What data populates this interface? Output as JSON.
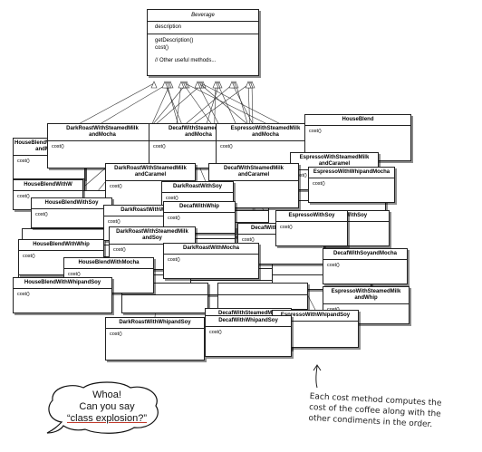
{
  "beverage": {
    "title": "Beverage",
    "field": "description",
    "method1": "getDescription()",
    "method2": "cost()",
    "method3": "// Other useful methods..."
  },
  "method_label": "cost()",
  "classes": [
    "HouseBlendWithSteamedMilk\nandMocha",
    "DarkRoastWithSteamedMilk\nandMocha",
    "DecafWithSteamedMilk\nandMocha",
    "EspressoWithSteamedMilk\nandMocha",
    "HouseBlend",
    "EspressoWithSteamedMilk\nandCaramel",
    "DarkRoastWithSteamedMilk\nandCaramel",
    "DecafWithSteamedMilk\nandCaramel",
    "EspressoWithWhipandMocha",
    "HouseBlendWithW",
    "DarkRoastWithSoy",
    "DecafWithSoy",
    "HouseBlendWithSoy",
    "DarkRoastWithWhip",
    "DecafWithWhip",
    "DarkRoastWithSteamedMilk\nandSoy",
    "DecafWithSteamedMilk",
    "EspressoWithSoy",
    "HouseBlendWithWhip",
    "DecafWithSoyandMocha",
    "HouseBlendWithMocha",
    "DarkRoastWithMocha",
    "EspressoWithSteamedMilk\nandWhip",
    "HouseBlendWithWhipandSoy",
    "DecafWithSteamedMilk\nandSoy",
    "EspressoWithWhipandSoy",
    "DarkRoastWithWhipandSoy",
    "DecafWithWhipandSoy"
  ],
  "bubble": {
    "line1": "Whoa!",
    "line2": "Can you say",
    "line3": "“class explosion?”"
  },
  "note": {
    "line1": "Each cost method computes the",
    "line2": "cost of the coffee along with the",
    "line3": "other condiments in the order."
  }
}
